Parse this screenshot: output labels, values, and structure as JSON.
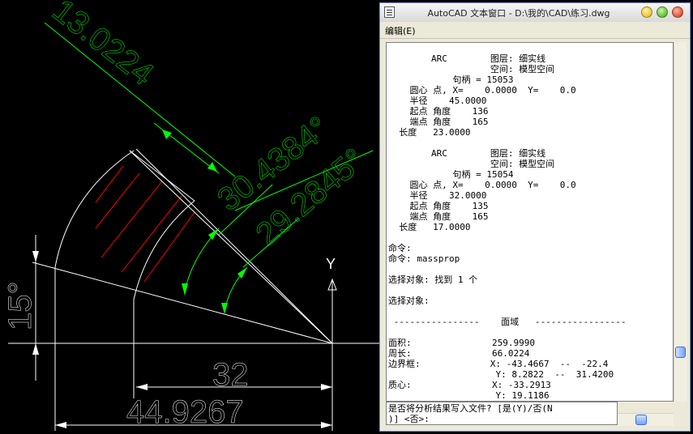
{
  "drawing": {
    "dim_arc_length_1": "13.0224",
    "dim_angle_1": "30.4384°",
    "dim_angle_2": "29.2845°",
    "dim_angle_3": "15°",
    "dim_linear_1": "32",
    "dim_linear_2": "44.9267",
    "axis_y_label": "Y",
    "colors": {
      "lines": "#ffffff",
      "dimensions": "#00ff00",
      "hatch": "#ff0000",
      "background": "#000000"
    }
  },
  "text_window": {
    "title": "AutoCAD 文本窗口 - D:\\我的\\CAD\\练习.dwg",
    "menu": {
      "edit": "编辑(E)"
    },
    "content": "\n        ARC        图层: 细实线\n                   空间: 模型空间\n            句柄 = 15053\n    圆心 点, X=    0.0000  Y=    0.0\n    半径    45.0000\n    起点 角度    136\n    端点 角度    165\n  长度   23.0000\n\n        ARC        图层: 细实线\n                   空间: 模型空间\n            句柄 = 15054\n    圆心 点, X=    0.0000  Y=    0.0\n    半径    32.0000\n    起点 角度    135\n    端点 角度    165\n  长度   17.0000\n\n命令:\n命令: massprop\n\n选择对象: 找到 1 个\n\n选择对象:\n\n ----------------    面域   -----------------\n\n面积:               259.9990\n周长:               66.0224\n边界框:             X: -43.4667  --  -22.4\n                    Y: 8.2822  --  31.4200\n质心:               X: -33.2913\n                    Y: 19.1186",
    "command_line": "是否将分析结果写入文件? [是(Y)/否(N\n)] <否>:"
  }
}
